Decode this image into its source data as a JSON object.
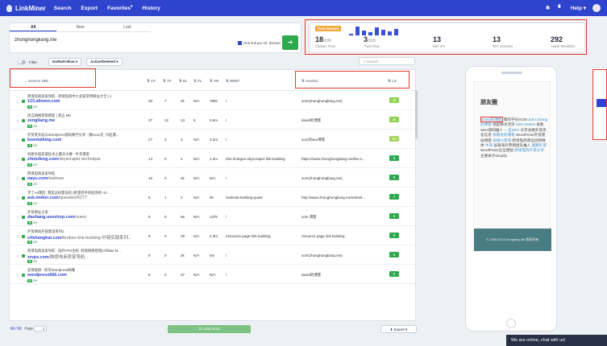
{
  "topbar": {
    "brand": "LinkMiner",
    "nav": [
      "Search",
      "Export",
      "Favorites",
      "History"
    ],
    "favorites_count": "0",
    "help": "Help"
  },
  "search_panel": {
    "tabs": [
      "All",
      "New",
      "Lost"
    ],
    "domain": "zhonghongliang.me",
    "one_link_per_ref_domain": "One link per ref. domain",
    "go_icon": "arrow-right-icon"
  },
  "stats": {
    "badge": "Root domain",
    "bar_heights": [
      0.2,
      0.9,
      0.5,
      0.3,
      0.8,
      0.6,
      0.4,
      0.7
    ],
    "citation_flow": {
      "value": "18",
      "max": "/100",
      "label": "Citation Flow"
    },
    "trust_flow": {
      "value": "3",
      "max": "/100",
      "label": "Trust Flow"
    },
    "ref_ips": {
      "value": "13",
      "label": "Ref. IPs"
    },
    "ref_domains": {
      "value": "13",
      "label": "Ref. domains"
    },
    "active_backlinks": {
      "value": "292",
      "label": "Active backlinks"
    }
  },
  "filters": {
    "filter_label": "Filter",
    "dofollow": "Do/NoFollow",
    "active_deleted": "Active/Deleted",
    "search_placeholder": "Search"
  },
  "table": {
    "headers": {
      "source_url": "Source URL",
      "cf": "CF",
      "tf": "TF",
      "el": "EL",
      "fl": "FL",
      "ar": "AR",
      "href": "HREF",
      "anchor": "Anchor",
      "ls": "LS"
    },
    "rows": [
      {
        "title": "跨境电商卖家导航 - 跨境电商中小卖家常用网址大全 | 1",
        "url": "123.allomn.com",
        "path": "",
        "lang": "ZH",
        "cf": "39",
        "tf": "7",
        "el": "2k",
        "fl": "N/A",
        "ar": "795k",
        "href": "/",
        "anchor": "som(zhonghongliang.me)",
        "ls": "23"
      },
      {
        "title": "黑五网络营销博客 | 黑五 ME",
        "url": "zengliang.me",
        "path": "",
        "lang": "ZH",
        "cf": "37",
        "tf": "12",
        "el": "13",
        "fl": "6",
        "ar": "3.6m",
        "href": "/",
        "anchor": "david的博客",
        "ls": "26"
      },
      {
        "title": "外贸英文站与Wordpress建站教学分享 - 跟Kees走, 兴起遇...",
        "url": "keentalking.com",
        "path": "",
        "lang": "ZH",
        "cf": "27",
        "tf": "3",
        "em": "",
        "el": "3",
        "fl": "N/A",
        "ar": "3.2m",
        "href": "/",
        "anchor": "som的seo博客",
        "ls": "16"
      },
      {
        "title": "谷歌外链获取技术之摩天大楼 - 牛哥博客",
        "url": "zhniufeng.com",
        "path": "/skyscraper-technique",
        "lang": "ZH",
        "cf": "14",
        "tf": "0",
        "el": "4",
        "fl": "N/A",
        "ar": "1.3m",
        "href": "/the-shotgun-skyscraper-link-building",
        "anchor": "https://www.zhonghongliang.me/the-s...",
        "ls": "8"
      },
      {
        "title": "跨境电商卖家导航",
        "url": "nayu.com",
        "path": "/waimao",
        "lang": "ZH",
        "cf": "15",
        "tf": "0",
        "el": "2k",
        "fl": "N/A",
        "ar": "N/A",
        "href": "/",
        "anchor": "som(zhonghongliang.me)",
        "ls": "8"
      },
      {
        "title": "学了Ad课后, 我是这样建设的 (希望老手的批改吧 -D! ...",
        "url": "ask.imiker.com",
        "path": "/question/6277",
        "lang": "ZH",
        "cf": "9",
        "tf": "1",
        "el": "2",
        "fl": "N/A",
        "ar": "5k",
        "href": "/website-building-guide",
        "anchor": "http://www.zhonghongliang.me/websit...",
        "ls": "7"
      },
      {
        "title": "外贸网址之家",
        "url": "daohang.ueeshop.com",
        "path": "/xuesi",
        "lang": "ZH",
        "cf": "8",
        "tf": "0",
        "el": "66",
        "fl": "N/A",
        "ar": "137k",
        "href": "/",
        "anchor": "som 博客",
        "ls": "6"
      },
      {
        "title": "外贸网站外链建设系列2",
        "url": "cifshanghai.com",
        "path": "/broken-link-building-外链实践系列...",
        "lang": "ZH",
        "cf": "8",
        "tf": "0",
        "el": "29",
        "fl": "N/A",
        "ar": "2.3m",
        "href": "/resource-page-link-building",
        "anchor": "resource page link building",
        "ls": "6"
      },
      {
        "title": "跨境电商卖家导航 - 国外VPS主机, 跨境网络营销(Affiliate M...",
        "url": "zrvps.com",
        "path": "/跨境电商卖家导航",
        "lang": "ZH",
        "cf": "8",
        "tf": "0",
        "el": "2k",
        "fl": "N/A",
        "ar": "5m",
        "href": "/",
        "anchor": "som(zhonghongliang.me)",
        "ls": "6"
      },
      {
        "title": "友情链接 - 阿苇Wordpress网赚",
        "url": "wordpress666.com",
        "path": "",
        "lang": "ZH",
        "cf": "8",
        "tf": "0",
        "el": "37",
        "fl": "N/A",
        "ar": "N/A",
        "href": "/",
        "anchor": "david的博客",
        "ls": "6"
      }
    ]
  },
  "footer": {
    "count": "52 / 52",
    "page_label": "Page",
    "page_value": "1",
    "load_more": "Load more",
    "export": "Export"
  },
  "preview": {
    "title": "朋友圈",
    "links": [
      {
        "text": "David的博客",
        "link": true,
        "boxed": true
      },
      {
        "text": " 我的学员SOM ",
        "link": false
      },
      {
        "text": "John Zhang的博客",
        "link": true
      },
      {
        "text": " 他是静水流深 ",
        "link": false
      },
      {
        "text": "SEO Daniel",
        "link": true
      },
      {
        "text": " 谷歌SEO第四推人 ",
        "link": false
      },
      {
        "text": "一全SEO",
        "link": true
      },
      {
        "text": " 分享谷歌外贸优化信息 ",
        "link": false
      },
      {
        "text": "张雨龙的博客",
        "link": true
      },
      {
        "text": " WordPress外贸建站博客 ",
        "link": false
      },
      {
        "text": "谷胡小李哥",
        "link": true
      },
      {
        "text": " 跨境电商周边创新媒体 ",
        "link": false
      },
      {
        "text": "牛哥",
        "link": true
      },
      {
        "text": " 谷歌海外营销团队推人 ",
        "link": false
      },
      {
        "text": "富鹏外贸",
        "link": true
      },
      {
        "text": " WordPress企业建站 ",
        "link": false
      },
      {
        "text": "跨境电商干货分享",
        "link": true
      },
      {
        "text": " 主要关于shopify",
        "link": false
      }
    ],
    "footer": "© 2008-2019 Zonglang.Me 版权所有"
  },
  "chat": "We are online, chat with us!"
}
